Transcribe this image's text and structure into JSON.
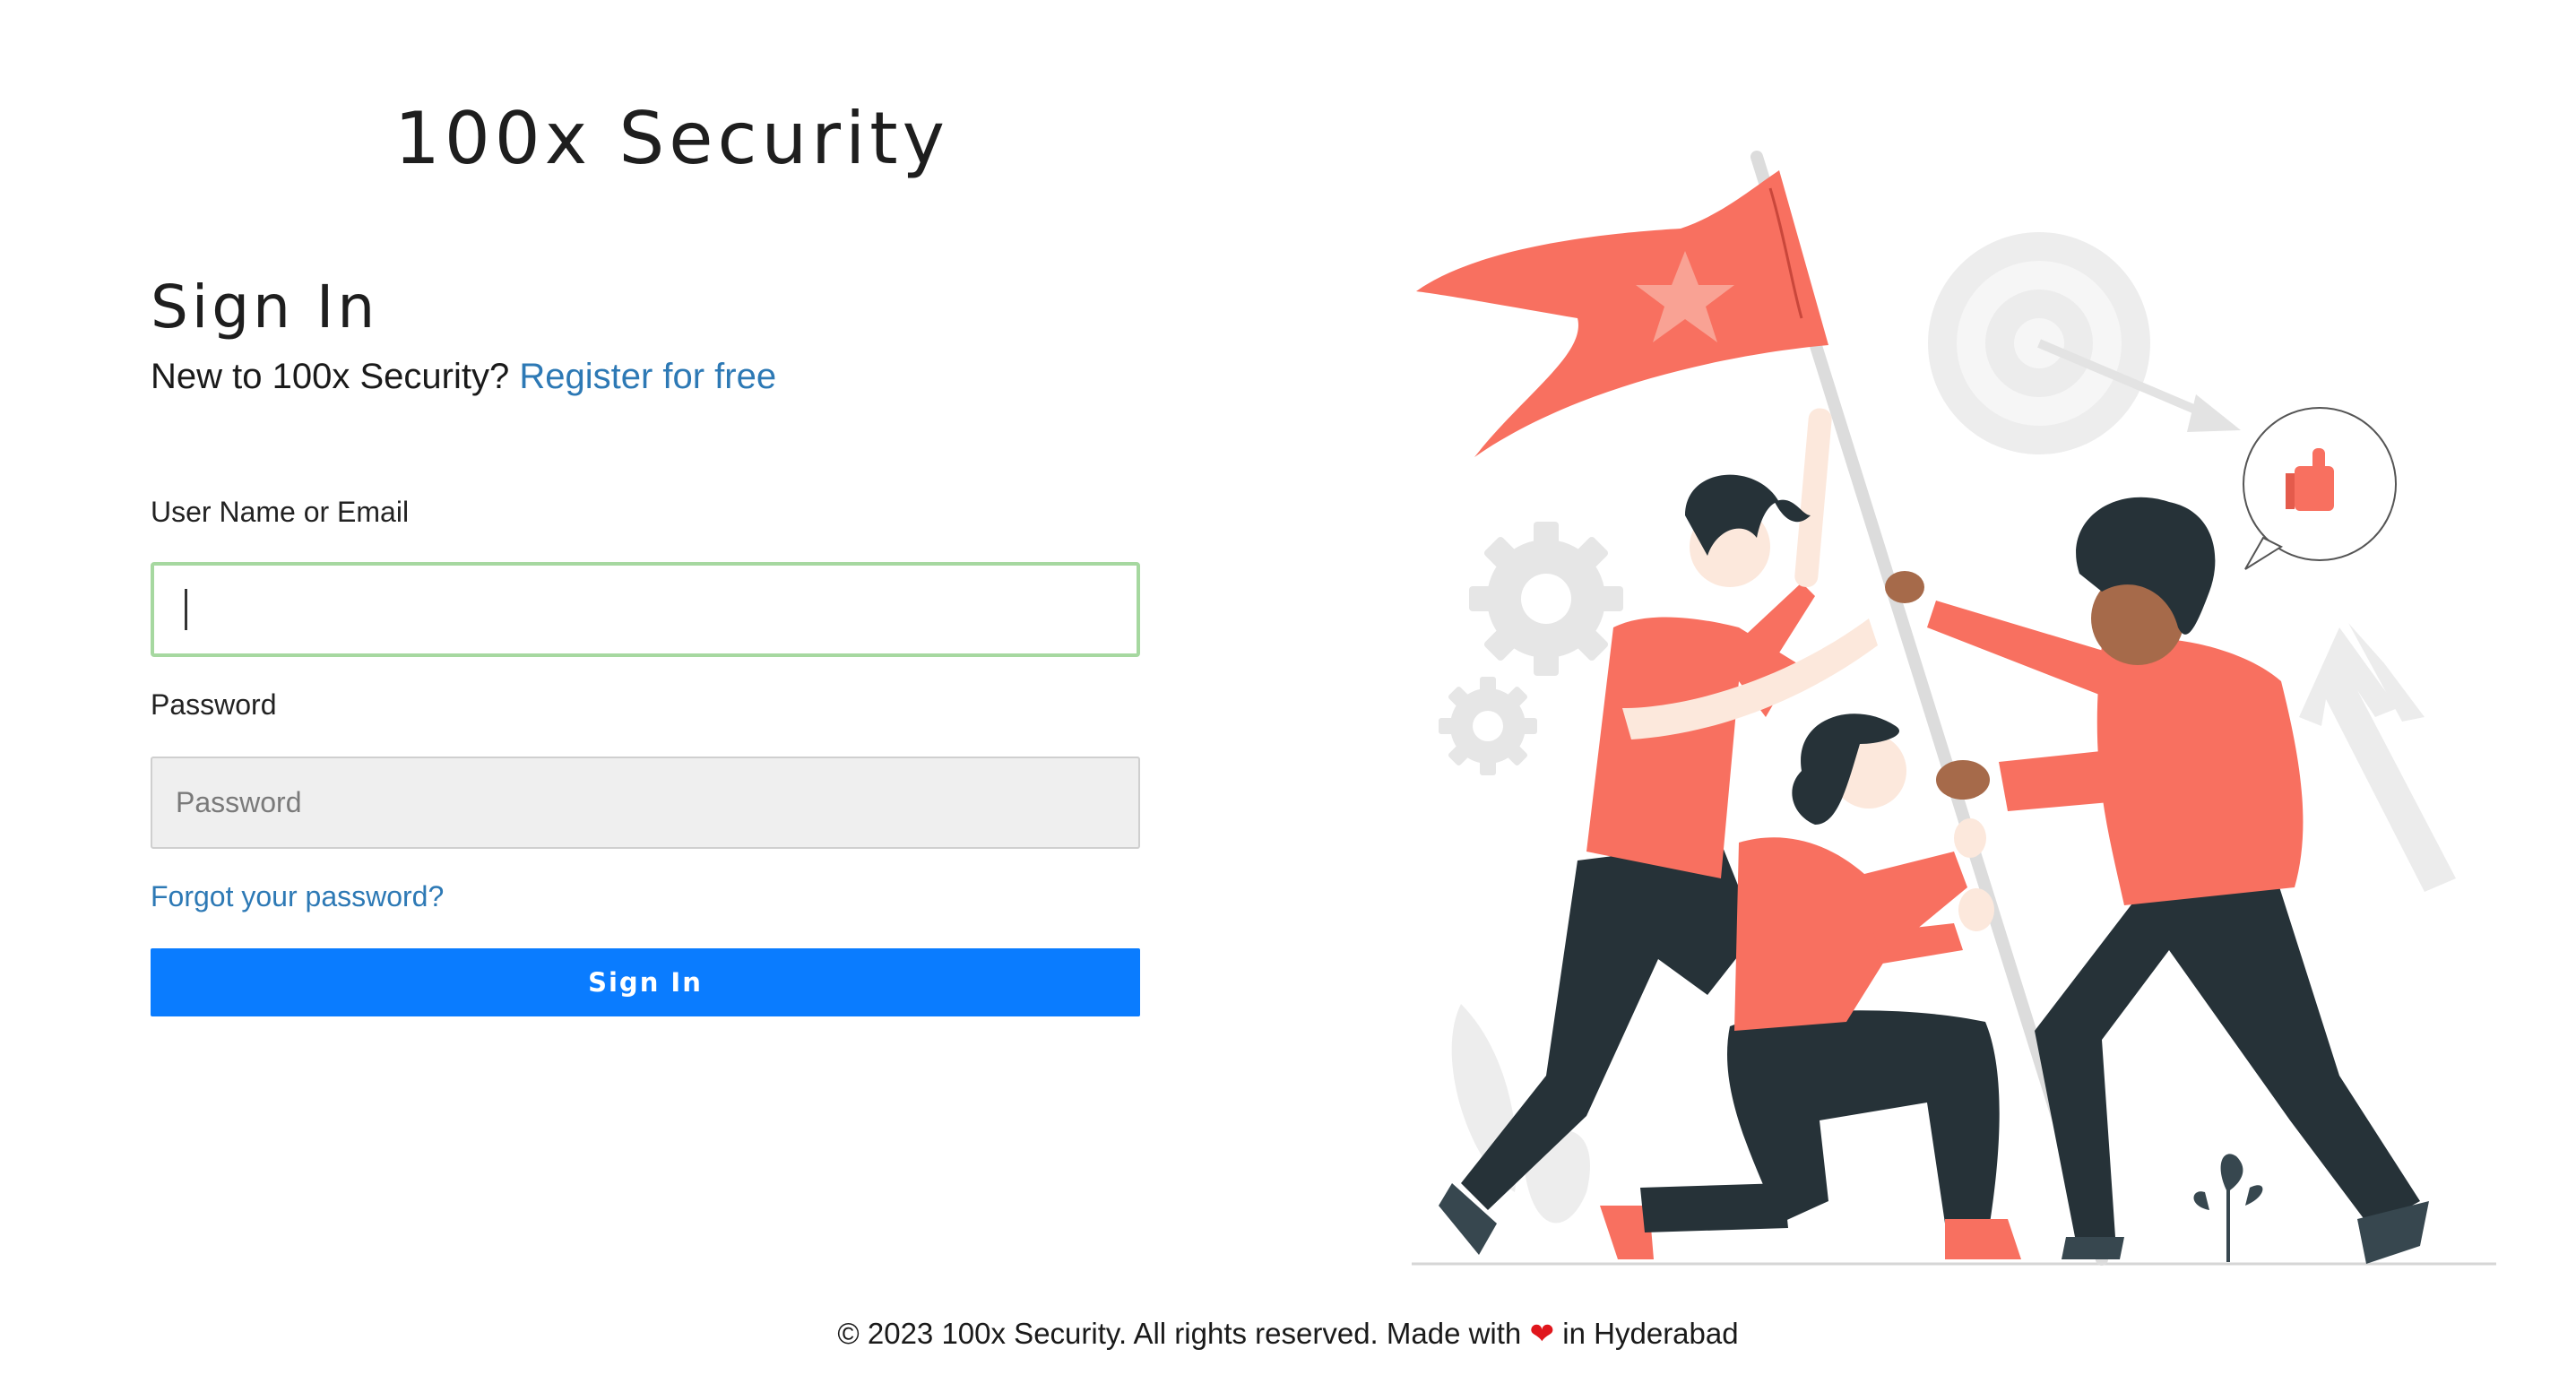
{
  "brand": {
    "title": "100x Security"
  },
  "signin": {
    "heading": "Sign In",
    "new_user_prefix": "New to 100x Security?",
    "register_link": "Register for free",
    "username_label": "User Name or Email",
    "username_value": "",
    "password_label": "Password",
    "password_placeholder": "Password",
    "forgot_link": "Forgot your password?",
    "submit_label": "Sign In"
  },
  "footer": {
    "prefix": "© 2023 100x Security. All rights reserved. Made with",
    "heart": "❤",
    "suffix": "in Hyderabad"
  },
  "colors": {
    "accent": "#0a7cff",
    "link": "#2d79b5",
    "focus_border": "#a6d8a0",
    "illustration_primary": "#f87060",
    "illustration_dark": "#263238"
  }
}
